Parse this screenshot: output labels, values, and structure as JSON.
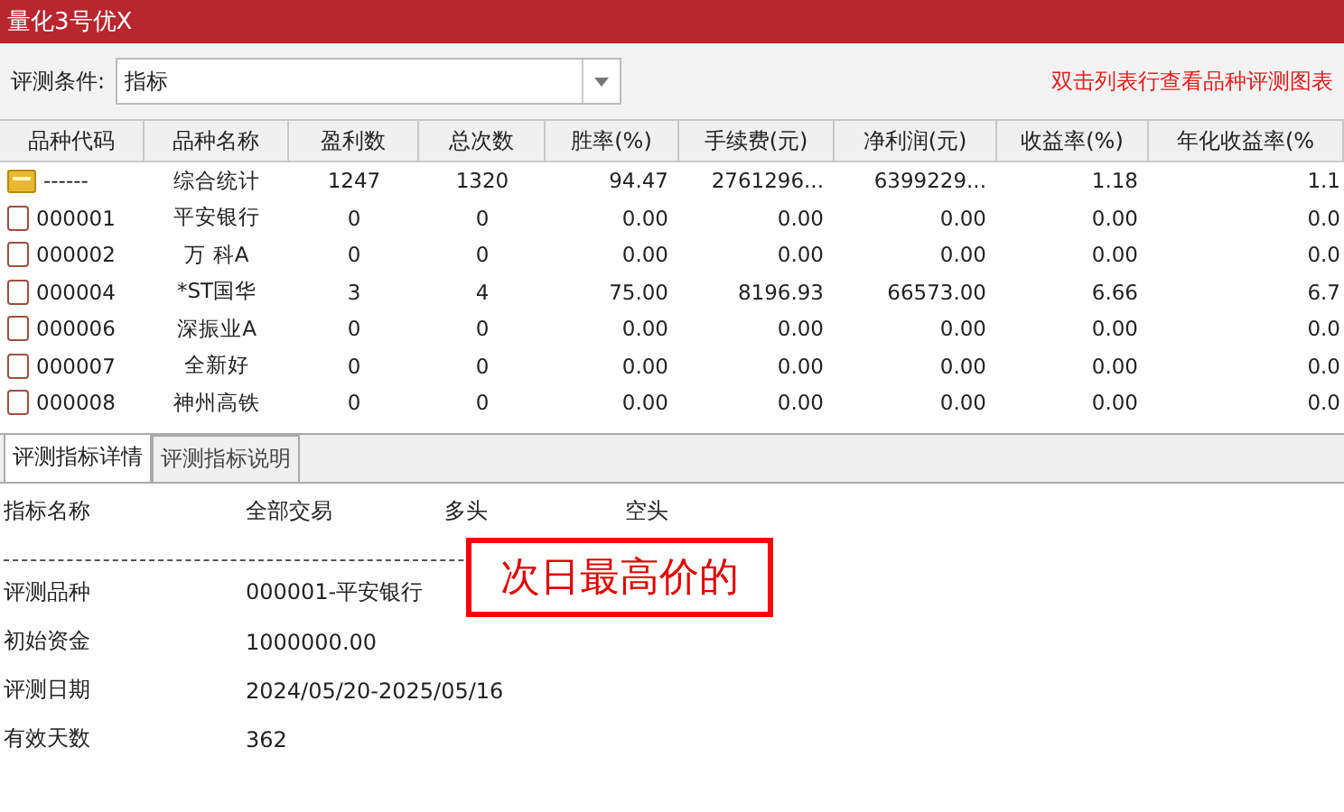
{
  "window": {
    "title": "量化3号优X"
  },
  "toolbar": {
    "label": "评测条件:",
    "dropdown_value": "指标",
    "hint": "双击列表行查看品种评测图表"
  },
  "table": {
    "columns": [
      "品种代码",
      "品种名称",
      "盈利数",
      "总次数",
      "胜率(%)",
      "手续费(元)",
      "净利润(元)",
      "收益率(%)",
      "年化收益率(%"
    ],
    "rows": [
      {
        "kind": "summary",
        "cells": [
          "------",
          "综合统计",
          "1247",
          "1320",
          "94.47",
          "2761296...",
          "6399229...",
          "1.18",
          "1.1"
        ]
      },
      {
        "kind": "stock",
        "cells": [
          "000001",
          "平安银行",
          "0",
          "0",
          "0.00",
          "0.00",
          "0.00",
          "0.00",
          "0.0"
        ]
      },
      {
        "kind": "stock",
        "cells": [
          "000002",
          "万 科A",
          "0",
          "0",
          "0.00",
          "0.00",
          "0.00",
          "0.00",
          "0.0"
        ]
      },
      {
        "kind": "stock",
        "cells": [
          "000004",
          "*ST国华",
          "3",
          "4",
          "75.00",
          "8196.93",
          "66573.00",
          "6.66",
          "6.7"
        ]
      },
      {
        "kind": "stock",
        "cells": [
          "000006",
          "深振业A",
          "0",
          "0",
          "0.00",
          "0.00",
          "0.00",
          "0.00",
          "0.0"
        ]
      },
      {
        "kind": "stock",
        "cells": [
          "000007",
          "全新好",
          "0",
          "0",
          "0.00",
          "0.00",
          "0.00",
          "0.00",
          "0.0"
        ]
      },
      {
        "kind": "stock",
        "cells": [
          "000008",
          "神州高铁",
          "0",
          "0",
          "0.00",
          "0.00",
          "0.00",
          "0.00",
          "0.0"
        ]
      }
    ]
  },
  "tabs": [
    {
      "label": "评测指标详情",
      "selected": true
    },
    {
      "label": "评测指标说明",
      "selected": false
    }
  ],
  "details": {
    "columns": [
      "指标名称",
      "全部交易",
      "多头",
      "空头"
    ],
    "rows": [
      {
        "name": "评测品种",
        "value": "000001-平安银行"
      },
      {
        "name": "初始资金",
        "value": "1000000.00"
      },
      {
        "name": "评测日期",
        "value": "2024/05/20-2025/05/16"
      },
      {
        "name": "有效天数",
        "value": "362"
      }
    ]
  },
  "annotation": {
    "text": "次日最高价的"
  }
}
